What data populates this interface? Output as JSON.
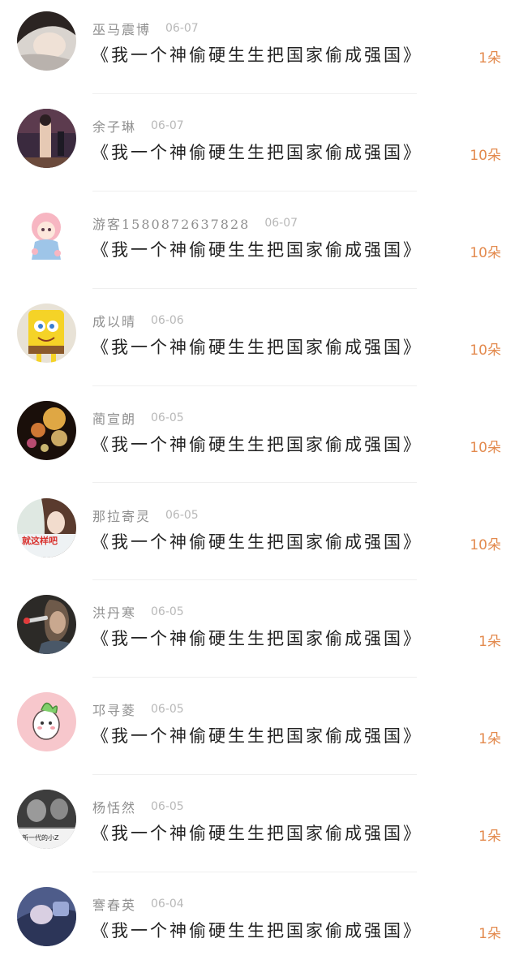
{
  "items": [
    {
      "name": "巫马震博",
      "date": "06-07",
      "title": "《我一个神偷硬生生把国家偷成强国》",
      "gift": "1朵"
    },
    {
      "name": "余子琳",
      "date": "06-07",
      "title": "《我一个神偷硬生生把国家偷成强国》",
      "gift": "10朵"
    },
    {
      "name": "游客1580872637828",
      "date": "06-07",
      "title": "《我一个神偷硬生生把国家偷成强国》",
      "gift": "10朵"
    },
    {
      "name": "成以晴",
      "date": "06-06",
      "title": "《我一个神偷硬生生把国家偷成强国》",
      "gift": "10朵"
    },
    {
      "name": "蔺宣朗",
      "date": "06-05",
      "title": "《我一个神偷硬生生把国家偷成强国》",
      "gift": "10朵"
    },
    {
      "name": "那拉寄灵",
      "date": "06-05",
      "title": "《我一个神偷硬生生把国家偷成强国》",
      "gift": "10朵"
    },
    {
      "name": "洪丹寒",
      "date": "06-05",
      "title": "《我一个神偷硬生生把国家偷成强国》",
      "gift": "1朵"
    },
    {
      "name": "邛寻菱",
      "date": "06-05",
      "title": "《我一个神偷硬生生把国家偷成强国》",
      "gift": "1朵"
    },
    {
      "name": "杨恬然",
      "date": "06-05",
      "title": "《我一个神偷硬生生把国家偷成强国》",
      "gift": "1朵"
    },
    {
      "name": "謇春英",
      "date": "06-04",
      "title": "《我一个神偷硬生生把国家偷成强国》",
      "gift": "1朵"
    }
  ],
  "avatar_texts": {
    "item6": "就这样吧",
    "item9": "新一代的小Z"
  },
  "colors": {
    "name": "#8f8f8f",
    "date": "#b8b8b8",
    "title": "#222222",
    "gift": "#e38a4e"
  }
}
